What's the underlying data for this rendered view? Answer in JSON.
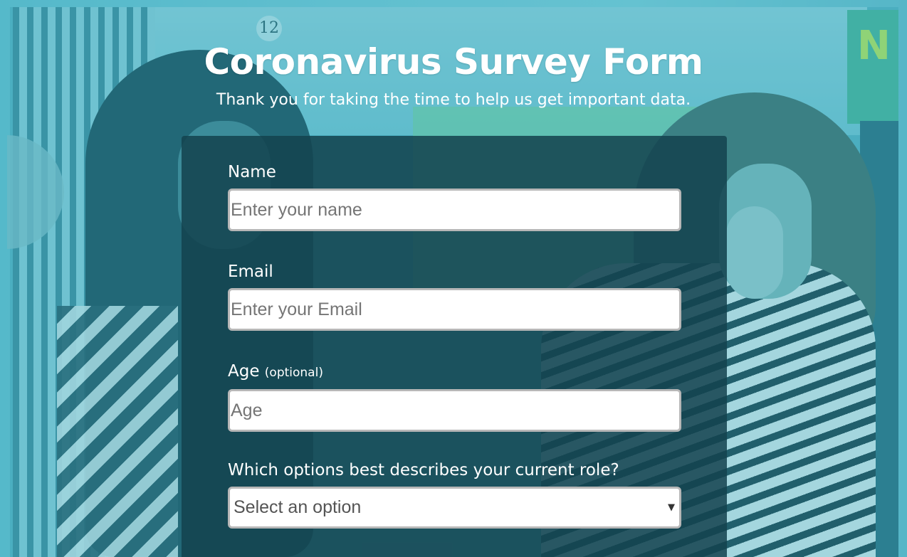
{
  "header": {
    "title": "Coronavirus Survey Form",
    "description": "Thank you for taking the time to help us get important data."
  },
  "background": {
    "clock_number": "12",
    "sign_letters": "N"
  },
  "form": {
    "name": {
      "label": "Name",
      "placeholder": "Enter your name",
      "value": ""
    },
    "email": {
      "label": "Email",
      "placeholder": "Enter your Email",
      "value": ""
    },
    "age": {
      "label": "Age",
      "label_note": "(optional)",
      "placeholder": "Age",
      "value": ""
    },
    "role": {
      "label": "Which options best describes your current role?",
      "selected": "Select an option",
      "icon": "dropdown-triangle-icon"
    }
  },
  "colors": {
    "panel": "#14424e",
    "page_tint": "#8fdcea",
    "text": "#ffffff",
    "input_border": "#b7b7b7"
  }
}
